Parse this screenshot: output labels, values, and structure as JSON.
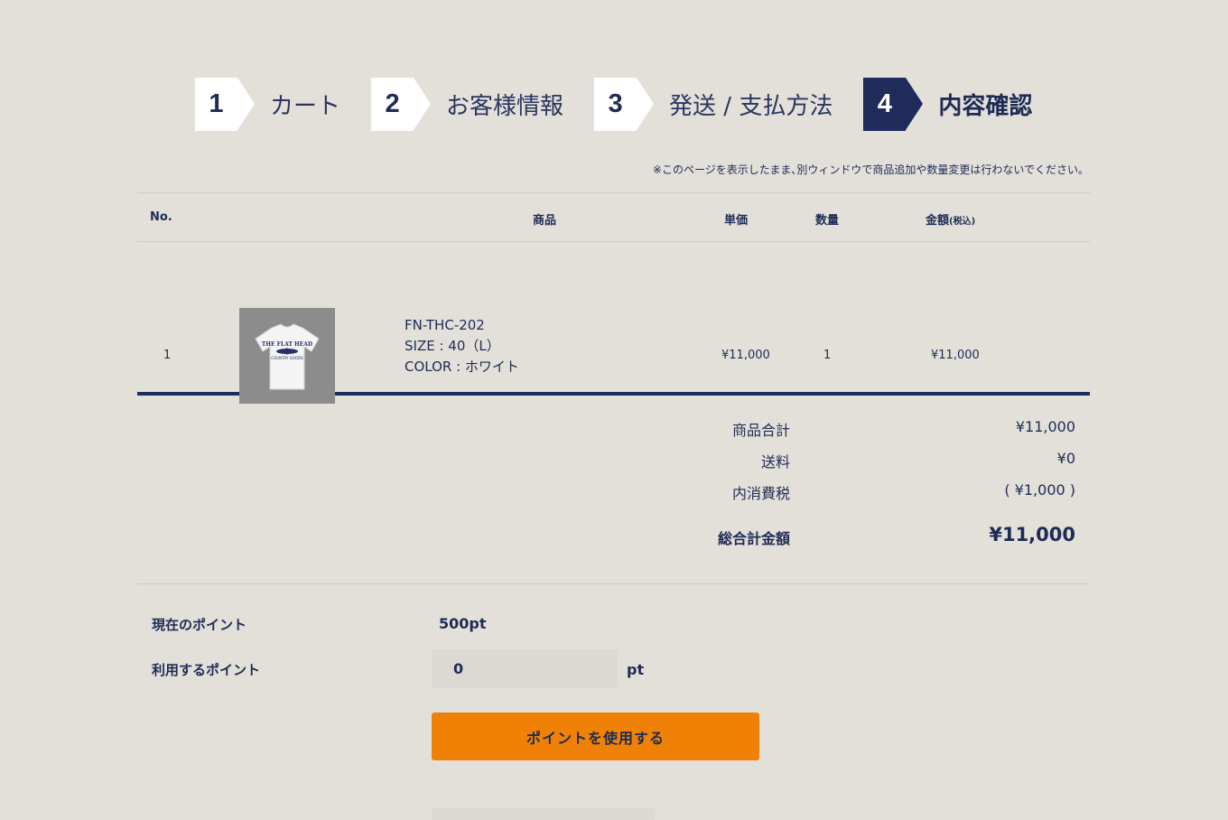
{
  "steps": [
    {
      "num": "1",
      "label": "カート"
    },
    {
      "num": "2",
      "label": "お客様情報"
    },
    {
      "num": "3",
      "label": "発送 / 支払方法"
    },
    {
      "num": "4",
      "label": "内容確認"
    }
  ],
  "notice": "※このページを表示したまま､別ウィンドウで商品追加や数量変更は行わないでください。",
  "table": {
    "headers": {
      "no": "No.",
      "product": "商品",
      "unit_price": "単価",
      "quantity": "数量",
      "amount": "金額",
      "tax_note": "(税込)"
    },
    "rows": [
      {
        "no": "1",
        "code": "FN-THC-202",
        "size": "SIZE : 40（L）",
        "color": "COLOR : ホワイト",
        "unit_price": "¥11,000",
        "quantity": "1",
        "amount": "¥11,000"
      }
    ]
  },
  "totals": {
    "subtotal_label": "商品合計",
    "subtotal": "¥11,000",
    "shipping_label": "送料",
    "shipping": "¥0",
    "tax_label": "内消費税",
    "tax": "( ¥1,000 )",
    "grand_label": "総合計金額",
    "grand": "¥11,000"
  },
  "points": {
    "current_label": "現在のポイント",
    "current_value": "500pt",
    "use_label": "利用するポイント",
    "use_value": "0",
    "unit": "pt",
    "button": "ポイントを使用する"
  }
}
